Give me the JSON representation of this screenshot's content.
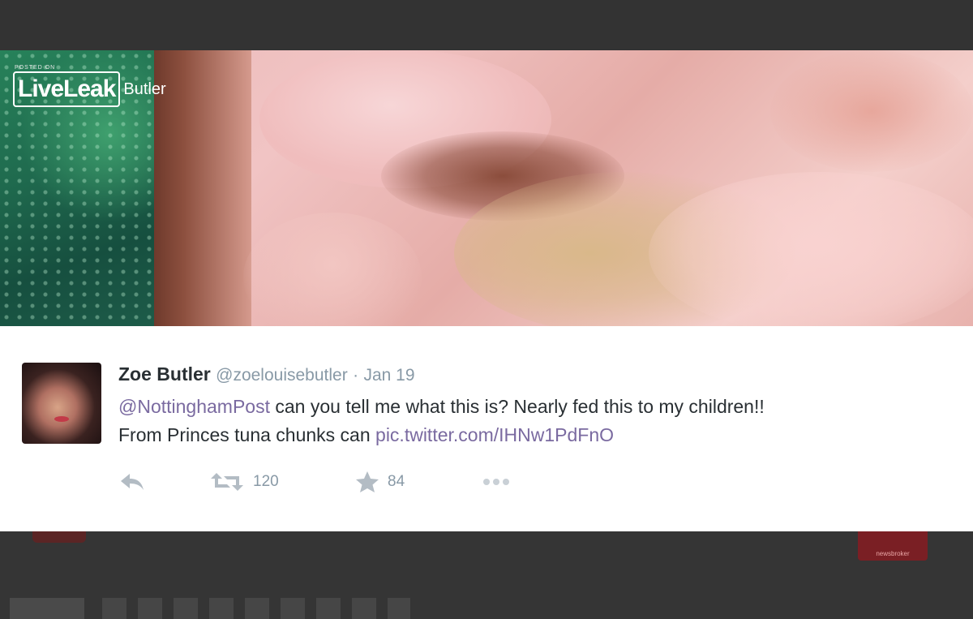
{
  "video": {
    "watermark": {
      "posted_on": "POSTED ON",
      "brand": "LiveLeak",
      "overlay_name": "Butler"
    },
    "channel_badge": {
      "text": "newsbroker"
    }
  },
  "tweet": {
    "name": "Zoe Butler",
    "handle": "@zoelouisebutler",
    "separator": "·",
    "date": "Jan 19",
    "mention": "@NottinghamPost",
    "text_line1": " can you tell me what this is? Nearly fed this to my children!!",
    "text_line2": "From Princes tuna chunks can ",
    "link": "pic.twitter.com/IHNw1PdFnO",
    "actions": {
      "reply_icon": "reply-icon",
      "retweet_icon": "retweet-icon",
      "retweet_count": "120",
      "favorite_icon": "star-icon",
      "favorite_count": "84",
      "more_icon": "more-icon"
    }
  },
  "colors": {
    "background": "#343434",
    "card": "#ffffff",
    "link": "#7a6aa0",
    "muted": "#8899a6",
    "text": "#292f33"
  }
}
